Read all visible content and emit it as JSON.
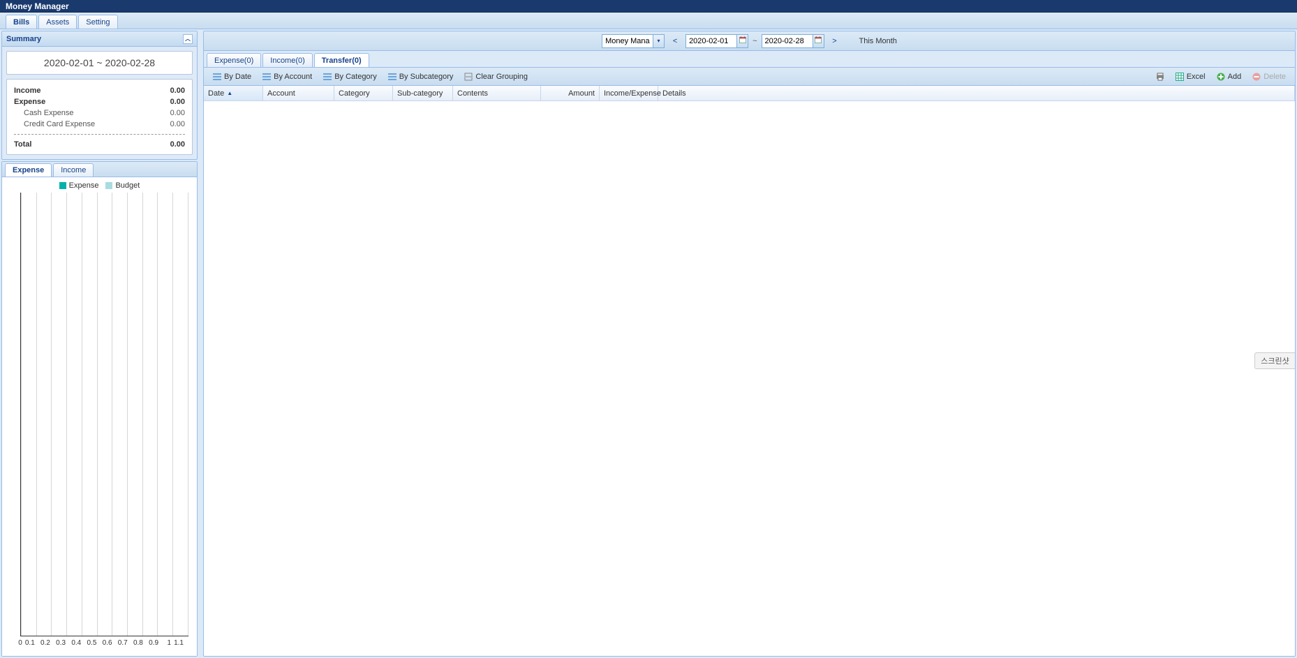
{
  "app": {
    "title": "Money Manager"
  },
  "topTabs": {
    "bills": "Bills",
    "assets": "Assets",
    "setting": "Setting"
  },
  "summary": {
    "header": "Summary",
    "dateRange": "2020-02-01  ~  2020-02-28",
    "rows": {
      "incomeLabel": "Income",
      "incomeValue": "0.00",
      "expenseLabel": "Expense",
      "expenseValue": "0.00",
      "cashExpLabel": "Cash Expense",
      "cashExpValue": "0.00",
      "ccExpLabel": "Credit Card Expense",
      "ccExpValue": "0.00",
      "totalLabel": "Total",
      "totalValue": "0.00"
    }
  },
  "chartTabs": {
    "expense": "Expense",
    "income": "Income"
  },
  "legend": {
    "expense": "Expense",
    "budget": "Budget"
  },
  "chart_data": {
    "type": "bar",
    "categories": [
      "0",
      "0.1",
      "0.2",
      "0.3",
      "0.4",
      "0.5",
      "0.6",
      "0.7",
      "0.8",
      "0.9",
      "1",
      "1.1"
    ],
    "series": [
      {
        "name": "Expense",
        "values": []
      },
      {
        "name": "Budget",
        "values": []
      }
    ],
    "title": "",
    "xlabel": "",
    "ylabel": "",
    "ylim": [
      0,
      1
    ]
  },
  "rightToolbar": {
    "accountCombo": "Money Manager",
    "prev": "<",
    "next": ">",
    "dateFrom": "2020-02-01",
    "dateTo": "2020-02-28",
    "tilde": "~",
    "thisMonth": "This Month"
  },
  "subTabs": {
    "expense": "Expense(0)",
    "income": "Income(0)",
    "transfer": "Transfer(0)"
  },
  "groupToolbar": {
    "byDate": "By Date",
    "byAccount": "By Account",
    "byCategory": "By Category",
    "bySubcategory": "By Subcategory",
    "clearGrouping": "Clear Grouping",
    "excel": "Excel",
    "add": "Add",
    "delete": "Delete"
  },
  "gridColumns": {
    "date": "Date",
    "account": "Account",
    "category": "Category",
    "subcategory": "Sub-category",
    "contents": "Contents",
    "amount": "Amount",
    "incomeExpense": "Income/Expense",
    "details": "Details"
  },
  "floatingBadge": "스크린샷",
  "colors": {
    "swatchExpense": "#00b2a9",
    "swatchBudget": "#a7dce0"
  }
}
